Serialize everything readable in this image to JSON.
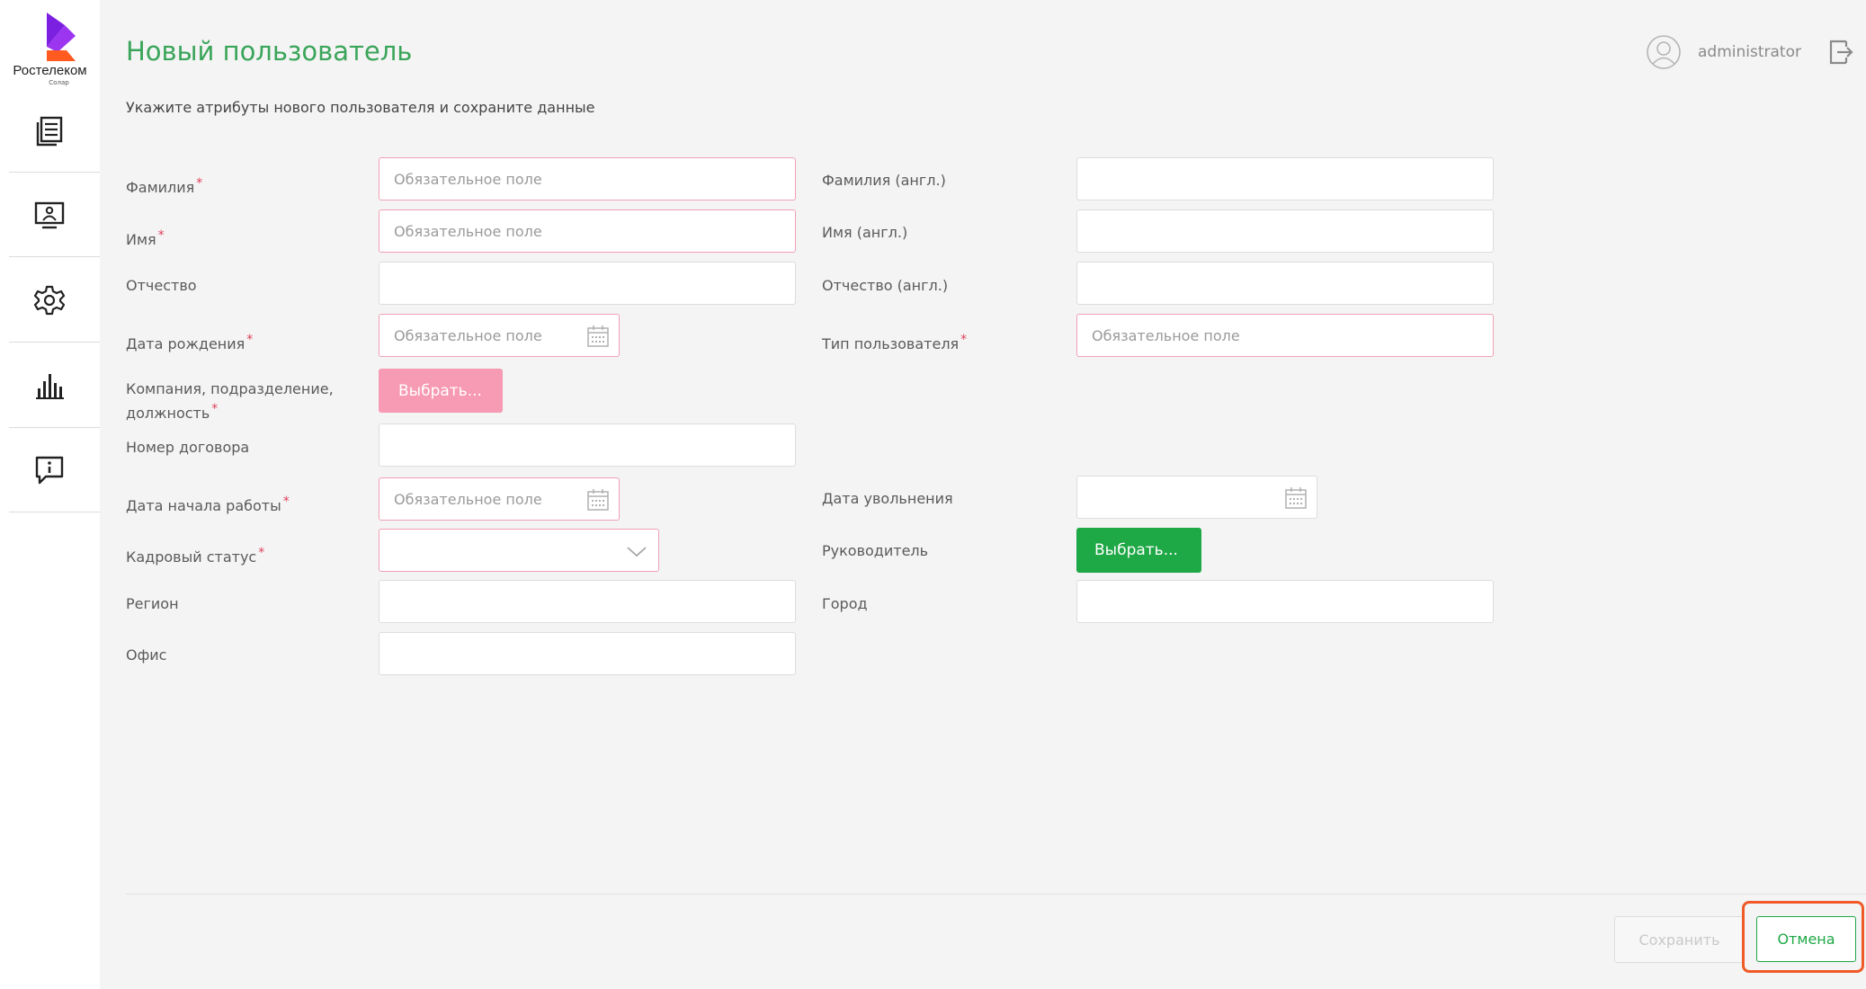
{
  "brand": {
    "name": "Ростелеком",
    "sub": "Солар",
    "colors": {
      "purple": "#7b1fe0",
      "orange": "#ff5a1f",
      "green": "#3aa55a",
      "required": "#e0405a"
    }
  },
  "sidebar": {
    "items": [
      {
        "id": "documents",
        "icon": "document-list-icon"
      },
      {
        "id": "monitor",
        "icon": "monitor-user-icon"
      },
      {
        "id": "settings",
        "icon": "gear-icon"
      },
      {
        "id": "reports",
        "icon": "bar-chart-icon"
      },
      {
        "id": "feedback",
        "icon": "info-chat-icon"
      }
    ]
  },
  "header": {
    "title": "Новый пользователь",
    "subtitle": "Укажите атрибуты нового пользователя и сохраните данные",
    "user": "administrator"
  },
  "form": {
    "required_mark": "*",
    "placeholder_required": "Обязательное поле",
    "last_name": {
      "label": "Фамилия",
      "value": ""
    },
    "first_name": {
      "label": "Имя",
      "value": ""
    },
    "middle_name": {
      "label": "Отчество",
      "value": ""
    },
    "birth_date": {
      "label": "Дата рождения",
      "value": ""
    },
    "company": {
      "label_line1": "Компания, подразделение,",
      "label_line2": "должность",
      "button": "Выбрать..."
    },
    "contract_number": {
      "label": "Номер договора",
      "value": ""
    },
    "start_date": {
      "label": "Дата начала работы",
      "value": ""
    },
    "hr_status": {
      "label": "Кадровый статус",
      "value": ""
    },
    "region": {
      "label": "Регион",
      "value": ""
    },
    "office": {
      "label": "Офис",
      "value": ""
    },
    "last_name_en": {
      "label": "Фамилия (англ.)",
      "value": ""
    },
    "first_name_en": {
      "label": "Имя (англ.)",
      "value": ""
    },
    "middle_name_en": {
      "label": "Отчество (англ.)",
      "value": ""
    },
    "user_type": {
      "label": "Тип пользователя",
      "value": ""
    },
    "dismissal_date": {
      "label": "Дата увольнения",
      "value": ""
    },
    "manager": {
      "label": "Руководитель",
      "button": "Выбрать..."
    },
    "city": {
      "label": "Город",
      "value": ""
    }
  },
  "footer": {
    "save": "Сохранить",
    "cancel": "Отмена"
  }
}
